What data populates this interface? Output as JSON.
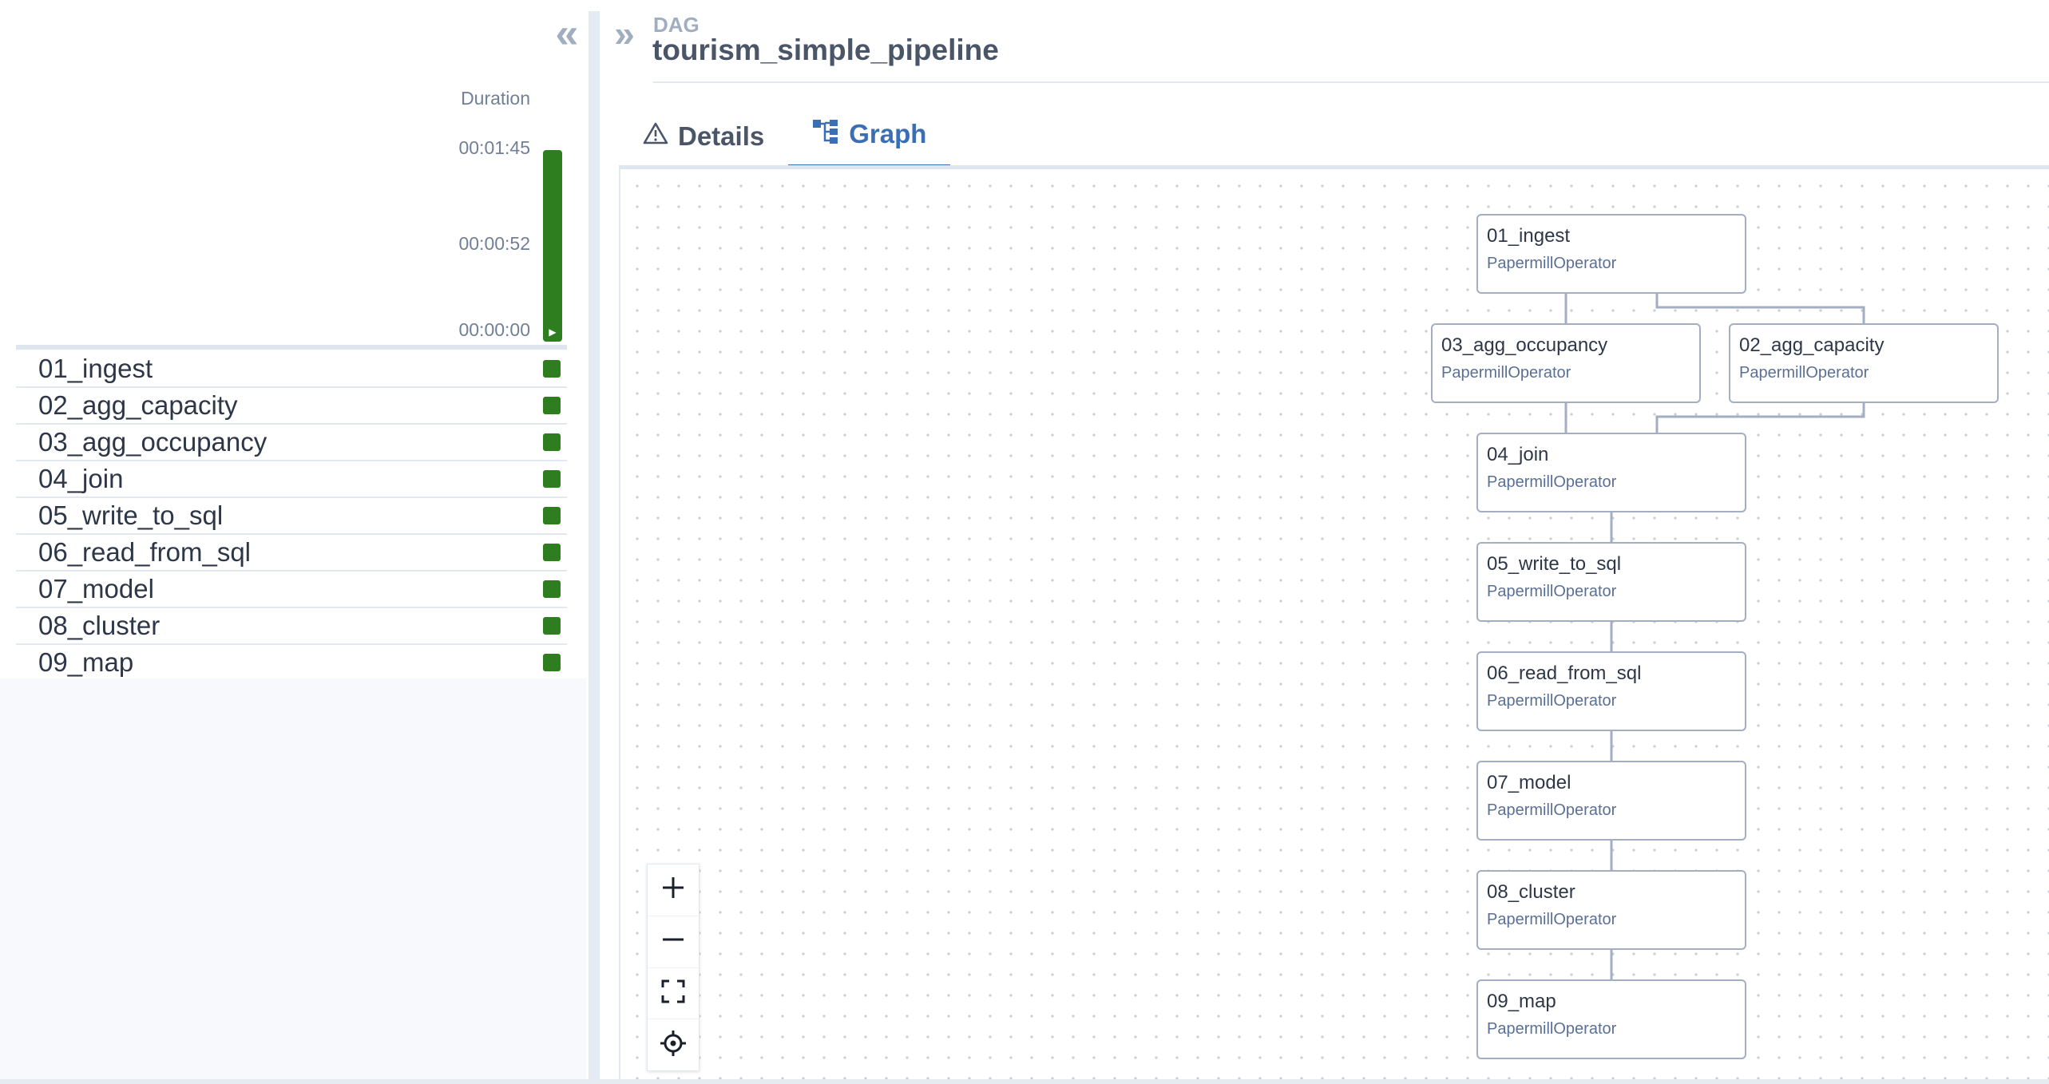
{
  "sidebar": {
    "collapse_glyph": "«",
    "duration_label": "Duration",
    "duration_ticks": [
      "00:01:45",
      "00:00:52",
      "00:00:00"
    ],
    "run_duration_fraction": 1.0,
    "tasks": [
      {
        "name": "01_ingest",
        "status": "success"
      },
      {
        "name": "02_agg_capacity",
        "status": "success"
      },
      {
        "name": "03_agg_occupancy",
        "status": "success"
      },
      {
        "name": "04_join",
        "status": "success"
      },
      {
        "name": "05_write_to_sql",
        "status": "success"
      },
      {
        "name": "06_read_from_sql",
        "status": "success"
      },
      {
        "name": "07_model",
        "status": "success"
      },
      {
        "name": "08_cluster",
        "status": "success"
      },
      {
        "name": "09_map",
        "status": "success"
      }
    ],
    "status_color": "#2e7d1f"
  },
  "header": {
    "expand_glyph": "»",
    "dag_label": "DAG",
    "dag_id": "tourism_simple_pipeline"
  },
  "tabs": [
    {
      "label": "Details",
      "icon": "warning-triangle-icon",
      "active": false
    },
    {
      "label": "Graph",
      "icon": "graph-icon",
      "active": true
    }
  ],
  "graph": {
    "nodes": [
      {
        "id": "01_ingest",
        "operator": "PapermillOperator"
      },
      {
        "id": "03_agg_occupancy",
        "operator": "PapermillOperator"
      },
      {
        "id": "02_agg_capacity",
        "operator": "PapermillOperator"
      },
      {
        "id": "04_join",
        "operator": "PapermillOperator"
      },
      {
        "id": "05_write_to_sql",
        "operator": "PapermillOperator"
      },
      {
        "id": "06_read_from_sql",
        "operator": "PapermillOperator"
      },
      {
        "id": "07_model",
        "operator": "PapermillOperator"
      },
      {
        "id": "08_cluster",
        "operator": "PapermillOperator"
      },
      {
        "id": "09_map",
        "operator": "PapermillOperator"
      }
    ],
    "controls": [
      "zoom-in-icon",
      "zoom-out-icon",
      "fit-view-icon",
      "center-icon"
    ]
  },
  "colors": {
    "accent": "#3b6fb4",
    "edge": "#a4aec2",
    "node_border": "#a4aec2"
  }
}
